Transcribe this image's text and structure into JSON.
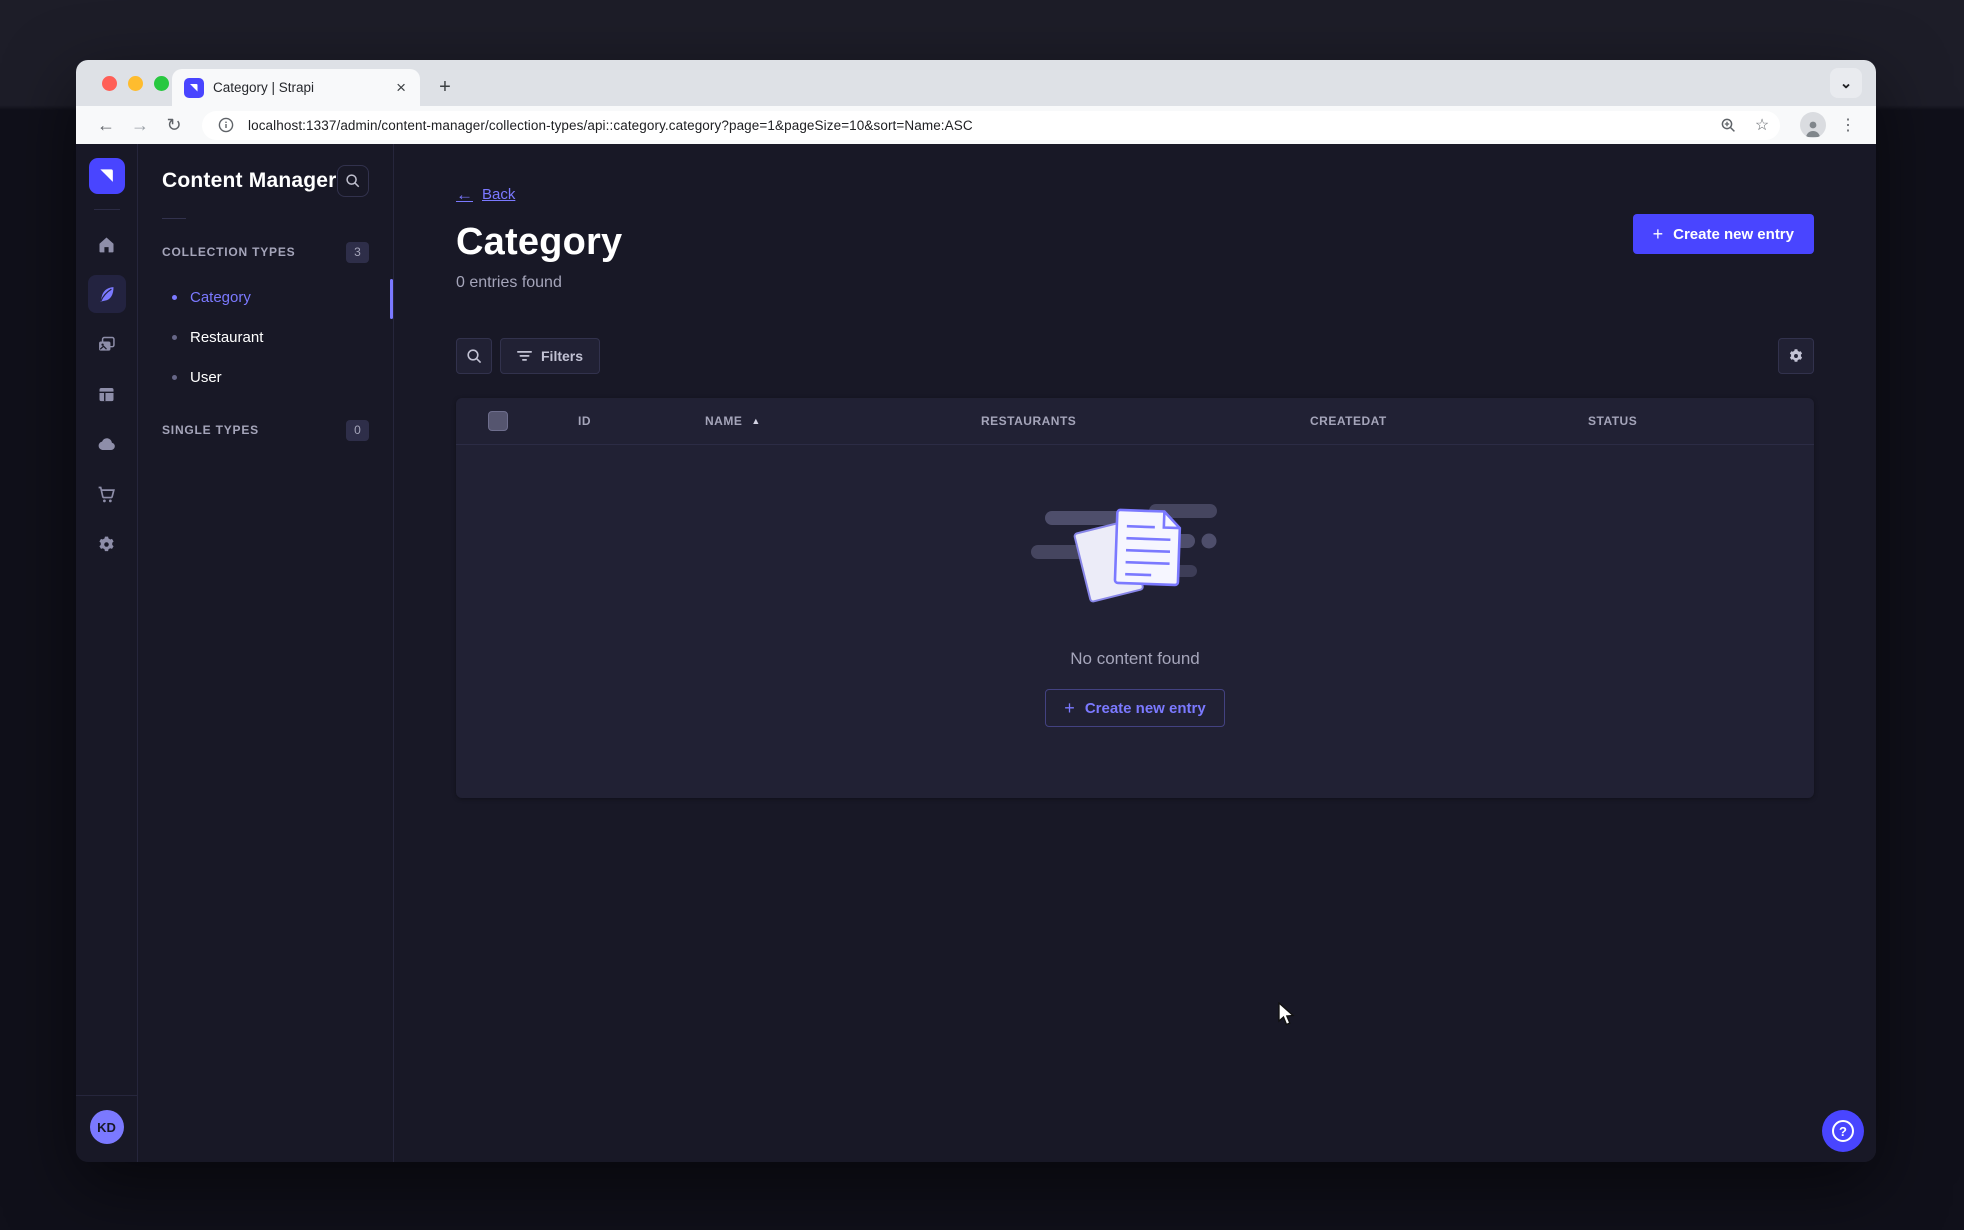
{
  "colors": {
    "accent": "#4945ff",
    "accent_light": "#7b79ff",
    "page_bg": "#181826",
    "card_bg": "#212134"
  },
  "browser": {
    "tab_title": "Category | Strapi",
    "url": "localhost:1337/admin/content-manager/collection-types/api::category.category?page=1&pageSize=10&sort=Name:ASC"
  },
  "icons": {
    "close": "×",
    "plus": "+",
    "back_arrow": "←",
    "forward_arrow": "→",
    "reload": "↻",
    "star": "☆",
    "overflow_dots": "⋮",
    "tab_chevron": "⌄",
    "sort_asc": "▲",
    "help": "?"
  },
  "sidebar": {
    "nav_items": [
      {
        "name": "home"
      },
      {
        "name": "content-manager",
        "active": true
      },
      {
        "name": "media-library"
      },
      {
        "name": "content-type-builder"
      },
      {
        "name": "cloud"
      },
      {
        "name": "marketplace"
      },
      {
        "name": "settings"
      }
    ],
    "avatar_initials": "KD"
  },
  "panel": {
    "title": "Content Manager",
    "collection_types": {
      "label": "COLLECTION TYPES",
      "badge": "3",
      "items": [
        {
          "label": "Category",
          "active": true
        },
        {
          "label": "Restaurant",
          "active": false
        },
        {
          "label": "User",
          "active": false
        }
      ]
    },
    "single_types": {
      "label": "SINGLE TYPES",
      "badge": "0"
    }
  },
  "main": {
    "back_label": "Back",
    "title": "Category",
    "entries_count": "0 entries found",
    "create_entry_label": "Create new entry",
    "filters_label": "Filters",
    "table": {
      "columns": [
        "ID",
        "NAME",
        "RESTAURANTS",
        "CREATEDAT",
        "STATUS"
      ],
      "sorted_column": "NAME",
      "sort_direction": "asc"
    },
    "empty_state": {
      "message": "No content found",
      "cta_label": "Create new entry"
    }
  }
}
